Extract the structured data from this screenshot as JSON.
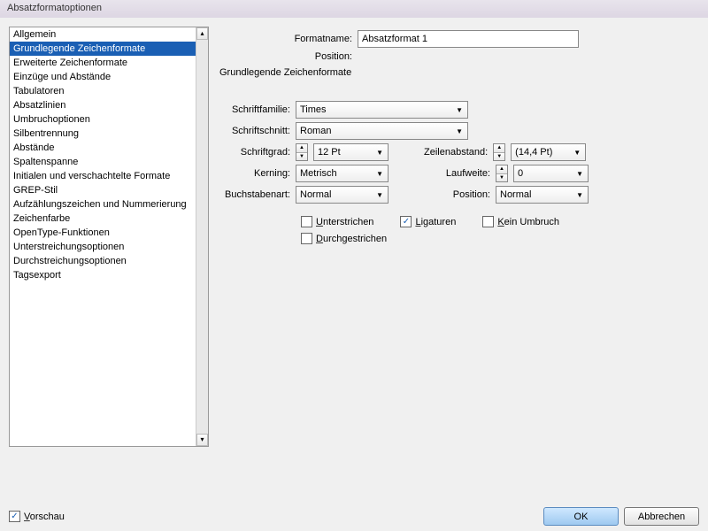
{
  "title": "Absatzformatoptionen",
  "sidebar": {
    "items": [
      "Allgemein",
      "Grundlegende Zeichenformate",
      "Erweiterte Zeichenformate",
      "Einzüge und Abstände",
      "Tabulatoren",
      "Absatzlinien",
      "Umbruchoptionen",
      "Silbentrennung",
      "Abstände",
      "Spaltenspanne",
      "Initialen und verschachtelte Formate",
      "GREP-Stil",
      "Aufzählungszeichen und Nummerierung",
      "Zeichenfarbe",
      "OpenType-Funktionen",
      "Unterstreichungsoptionen",
      "Durchstreichungsoptionen",
      "Tagsexport"
    ],
    "selected_index": 1
  },
  "header": {
    "formatname_label": "Formatname:",
    "formatname_value": "Absatzformat 1",
    "position_label": "Position:",
    "section_title": "Grundlegende Zeichenformate"
  },
  "fields": {
    "schriftfamilie": {
      "label": "Schriftfamilie:",
      "value": "Times"
    },
    "schriftschnitt": {
      "label": "Schriftschnitt:",
      "value": "Roman"
    },
    "schriftgrad": {
      "label": "Schriftgrad:",
      "value": "12 Pt"
    },
    "zeilenabstand": {
      "label": "Zeilenabstand:",
      "value": "(14,4 Pt)"
    },
    "kerning": {
      "label": "Kerning:",
      "value": "Metrisch"
    },
    "laufweite": {
      "label": "Laufweite:",
      "value": "0"
    },
    "buchstabenart": {
      "label": "Buchstabenart:",
      "value": "Normal"
    },
    "position": {
      "label": "Position:",
      "value": "Normal"
    }
  },
  "checkboxes": {
    "unterstrichen": {
      "label": "Unterstrichen",
      "checked": false
    },
    "ligaturen": {
      "label": "Ligaturen",
      "checked": true
    },
    "kein_umbruch": {
      "label": "Kein Umbruch",
      "checked": false
    },
    "durchgestrichen": {
      "label": "Durchgestrichen",
      "checked": false
    }
  },
  "footer": {
    "vorschau": {
      "label": "Vorschau",
      "checked": true
    },
    "ok": "OK",
    "cancel": "Abbrechen"
  }
}
